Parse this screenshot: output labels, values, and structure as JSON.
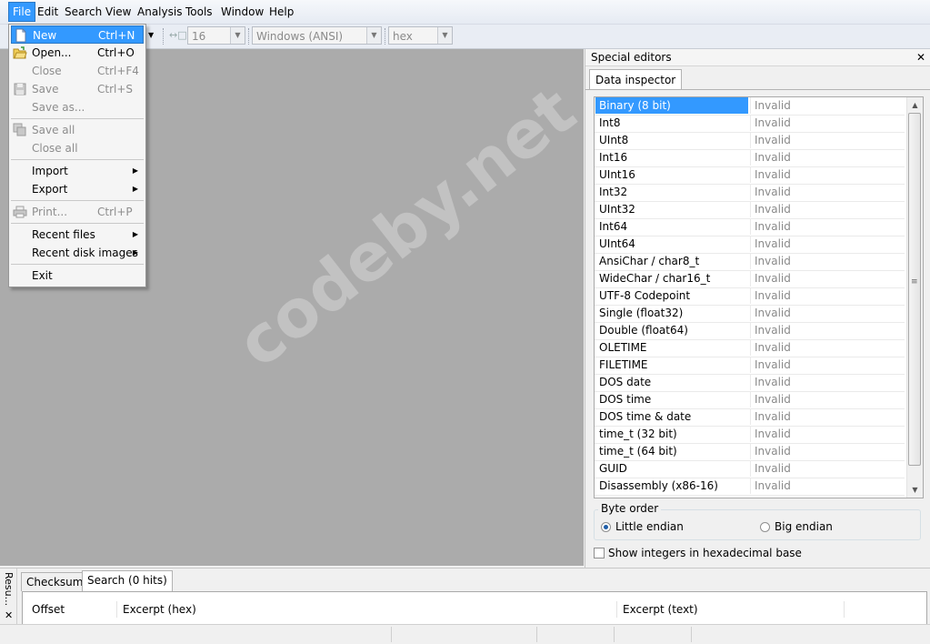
{
  "menubar": [
    "File",
    "Edit",
    "Search",
    "View",
    "Analysis",
    "Tools",
    "Window",
    "Help"
  ],
  "toolbar": {
    "width_value": "16",
    "encoding": "Windows (ANSI)",
    "display_mode": "hex"
  },
  "file_menu": {
    "items": [
      {
        "label": "New",
        "shortcut": "Ctrl+N",
        "icon": "new-file-icon"
      },
      {
        "label": "Open...",
        "shortcut": "Ctrl+O",
        "icon": "open-folder-icon"
      },
      {
        "label": "Close",
        "shortcut": "Ctrl+F4"
      },
      {
        "label": "Save",
        "shortcut": "Ctrl+S",
        "icon": "floppy-disk-icon"
      },
      {
        "label": "Save as..."
      },
      {
        "label": "Save all",
        "icon": "save-all-icon"
      },
      {
        "label": "Close all"
      },
      {
        "label": "Import"
      },
      {
        "label": "Export"
      },
      {
        "label": "Print...",
        "shortcut": "Ctrl+P",
        "icon": "printer-icon"
      },
      {
        "label": "Recent files"
      },
      {
        "label": "Recent disk images"
      },
      {
        "label": "Exit"
      }
    ]
  },
  "watermark": "codeby.net",
  "special_editors": {
    "title": "Special editors",
    "tab": "Data inspector",
    "rows": [
      {
        "type": "Binary (8 bit)",
        "value": "Invalid"
      },
      {
        "type": "Int8",
        "value": "Invalid"
      },
      {
        "type": "UInt8",
        "value": "Invalid"
      },
      {
        "type": "Int16",
        "value": "Invalid"
      },
      {
        "type": "UInt16",
        "value": "Invalid"
      },
      {
        "type": "Int32",
        "value": "Invalid"
      },
      {
        "type": "UInt32",
        "value": "Invalid"
      },
      {
        "type": "Int64",
        "value": "Invalid"
      },
      {
        "type": "UInt64",
        "value": "Invalid"
      },
      {
        "type": "AnsiChar / char8_t",
        "value": "Invalid"
      },
      {
        "type": "WideChar / char16_t",
        "value": "Invalid"
      },
      {
        "type": "UTF-8 Codepoint",
        "value": "Invalid"
      },
      {
        "type": "Single (float32)",
        "value": "Invalid"
      },
      {
        "type": "Double (float64)",
        "value": "Invalid"
      },
      {
        "type": "OLETIME",
        "value": "Invalid"
      },
      {
        "type": "FILETIME",
        "value": "Invalid"
      },
      {
        "type": "DOS date",
        "value": "Invalid"
      },
      {
        "type": "DOS time",
        "value": "Invalid"
      },
      {
        "type": "DOS time & date",
        "value": "Invalid"
      },
      {
        "type": "time_t (32 bit)",
        "value": "Invalid"
      },
      {
        "type": "time_t (64 bit)",
        "value": "Invalid"
      },
      {
        "type": "GUID",
        "value": "Invalid"
      },
      {
        "type": "Disassembly (x86-16)",
        "value": "Invalid"
      }
    ],
    "byte_order": {
      "label": "Byte order",
      "little": "Little endian",
      "big": "Big endian"
    },
    "hex_checkbox": "Show integers in hexadecimal base"
  },
  "results": {
    "side_label": "Resu...",
    "tabs": [
      "Checksum",
      "Search (0 hits)"
    ],
    "columns": [
      "Offset",
      "Excerpt (hex)",
      "Excerpt (text)"
    ]
  }
}
